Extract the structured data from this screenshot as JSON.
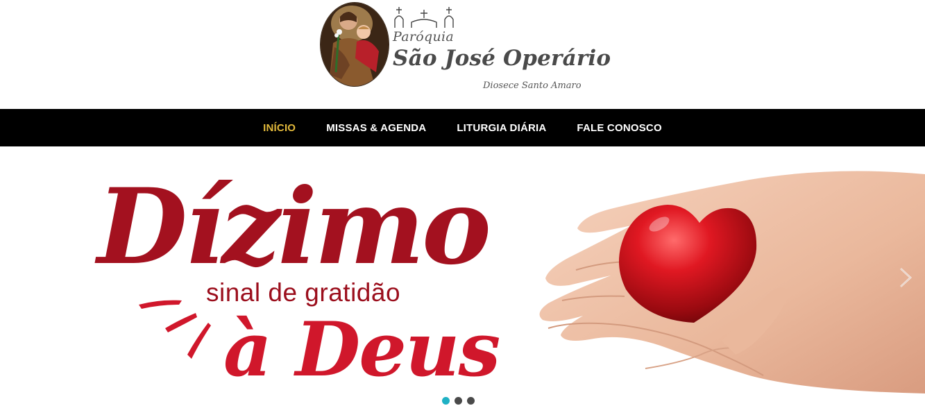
{
  "logo": {
    "small": "Paróquia",
    "big": "São José Operário",
    "sub": "Diosece Santo Amaro"
  },
  "nav": [
    {
      "label": "INÍCIO",
      "active": true
    },
    {
      "label": "MISSAS & AGENDA",
      "active": false
    },
    {
      "label": "LITURGIA DIÁRIA",
      "active": false
    },
    {
      "label": "FALE CONOSCO",
      "active": false
    }
  ],
  "slide": {
    "headline": "Dízimo",
    "tagline": "sinal de gratidão",
    "footer_text": "à Deus",
    "image": "hands-holding-red-heart"
  },
  "slider": {
    "next_icon": "chevron-right-icon",
    "dots": [
      {
        "active": true
      },
      {
        "active": false
      },
      {
        "active": false
      }
    ]
  },
  "colors": {
    "nav_bg": "#000000",
    "nav_active": "#e2b93b",
    "headline_red": "#a3111f",
    "dot_active": "#1fb1c4"
  }
}
